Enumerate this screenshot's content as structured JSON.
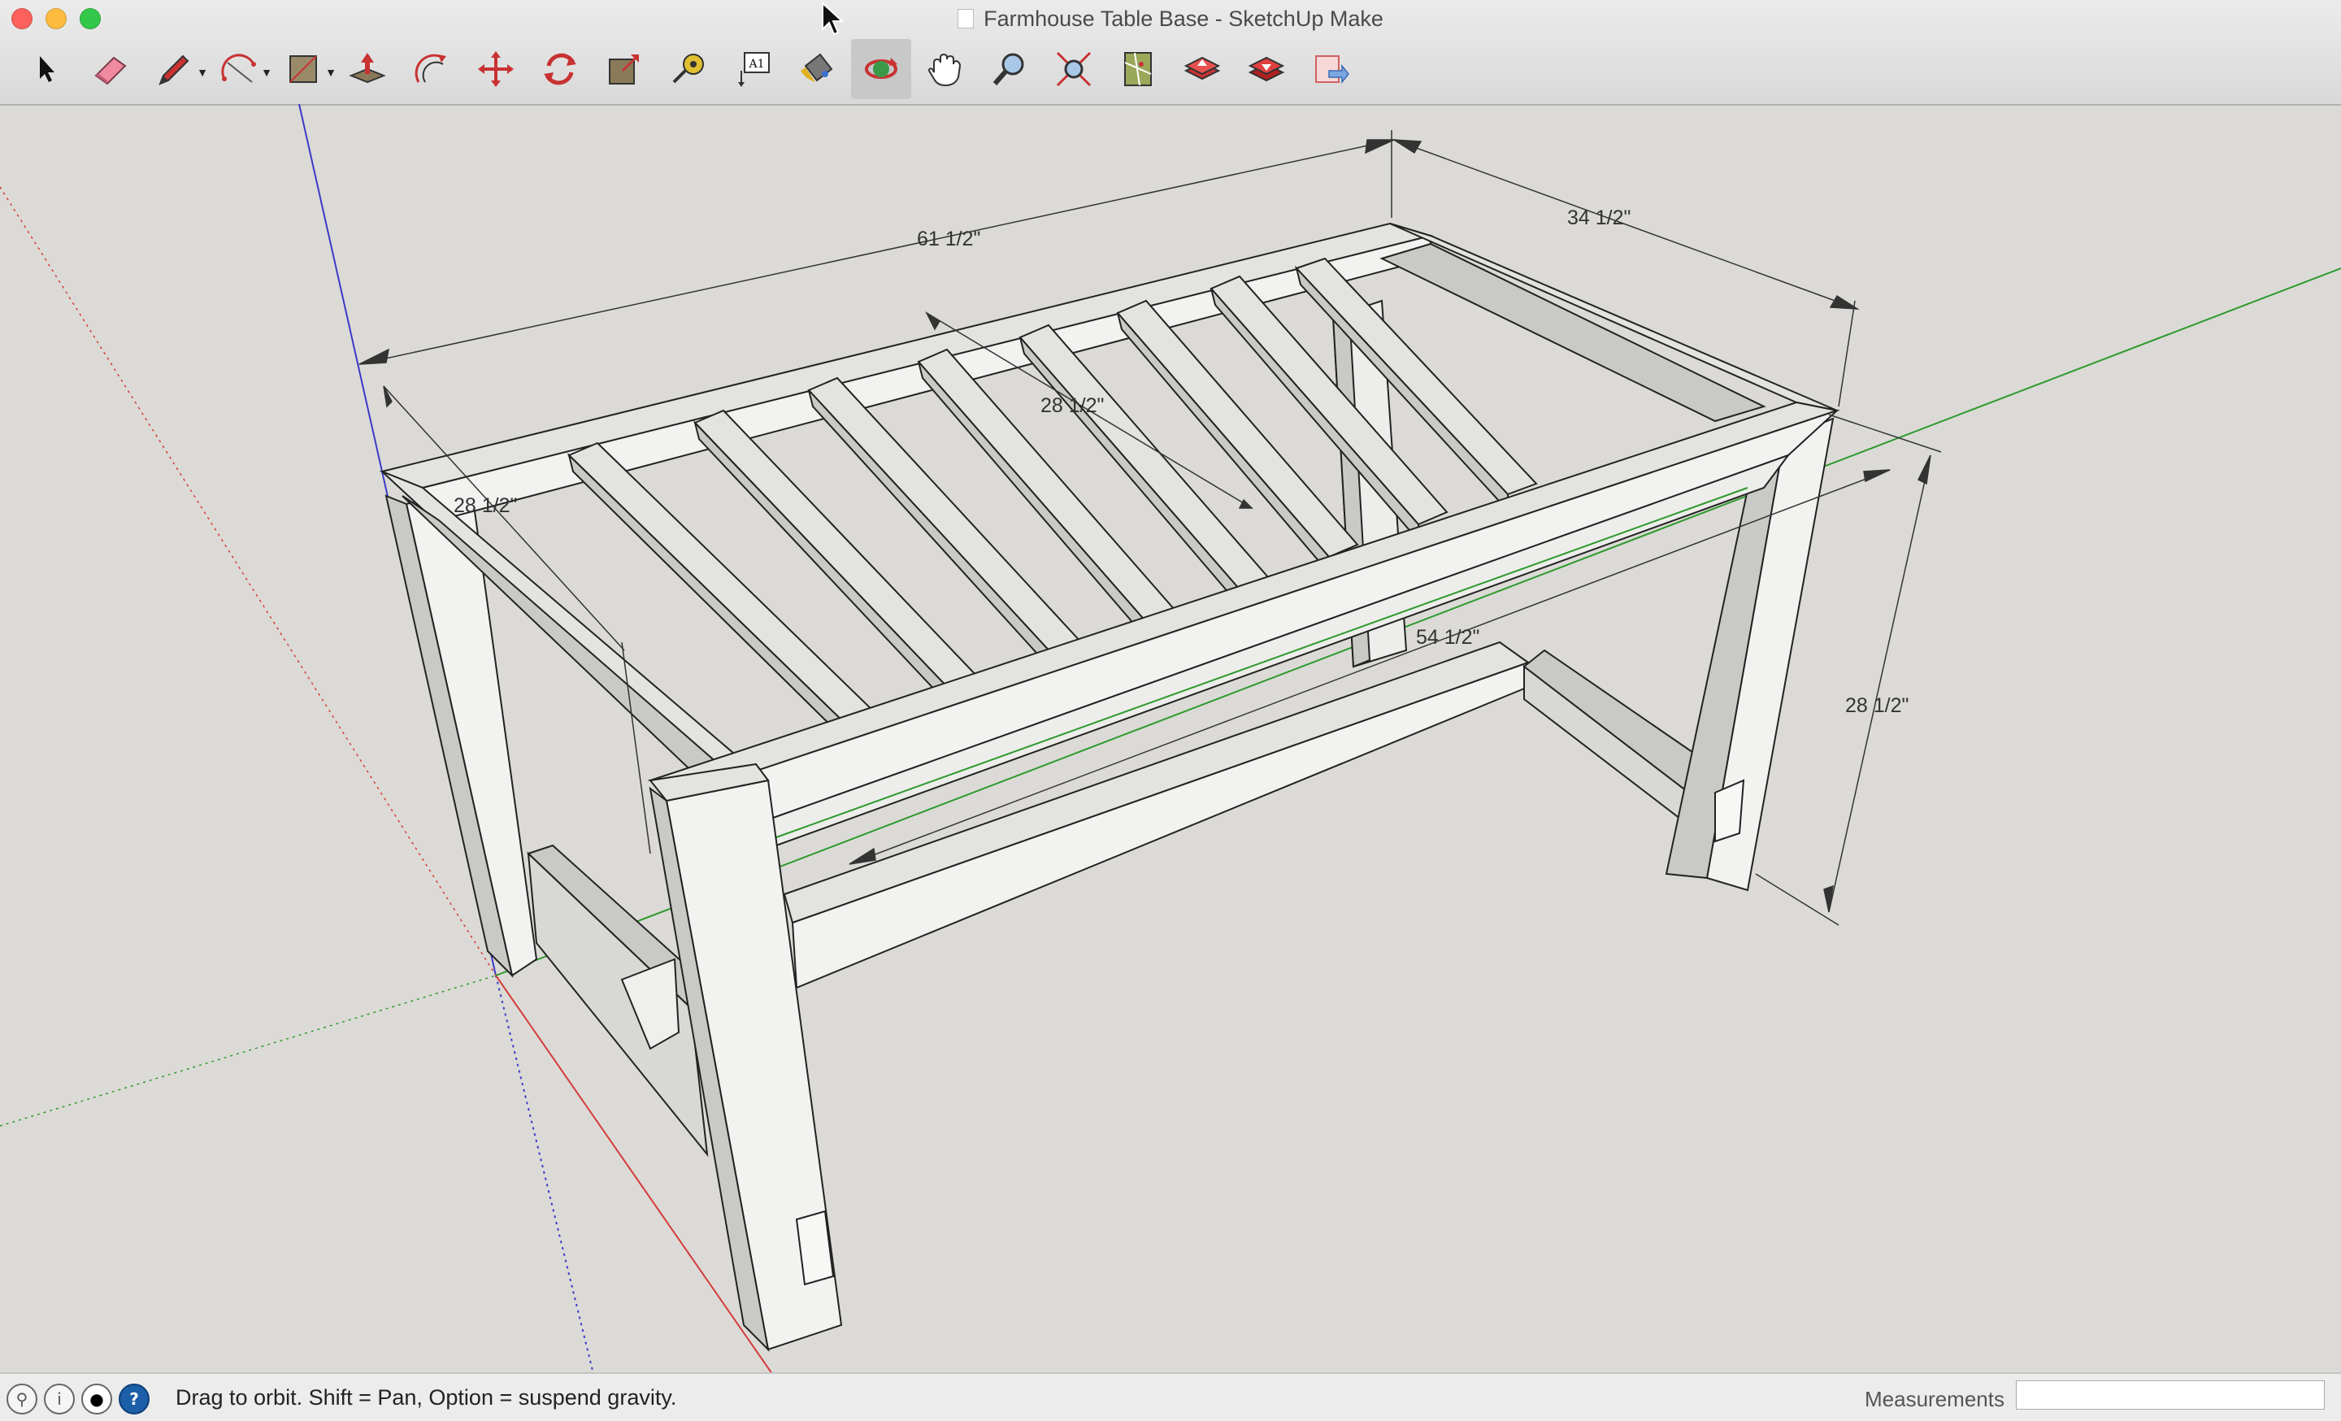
{
  "window": {
    "title": "Farmhouse Table Base - SketchUp Make"
  },
  "toolbar": {
    "tools": [
      {
        "name": "select-tool",
        "icon": "arrow-icon"
      },
      {
        "name": "eraser-tool",
        "icon": "eraser-icon"
      },
      {
        "name": "line-tool",
        "icon": "pencil-icon"
      },
      {
        "name": "arc-tool",
        "icon": "arc-icon"
      },
      {
        "name": "rectangle-tool",
        "icon": "rectangle-icon"
      },
      {
        "name": "push-pull-tool",
        "icon": "push-pull-icon"
      },
      {
        "name": "offset-tool",
        "icon": "offset-icon"
      },
      {
        "name": "move-tool",
        "icon": "move-icon"
      },
      {
        "name": "rotate-tool",
        "icon": "rotate-icon"
      },
      {
        "name": "scale-tool",
        "icon": "scale-icon"
      },
      {
        "name": "tape-measure-tool",
        "icon": "tape-measure-icon"
      },
      {
        "name": "text-tool",
        "icon": "text-icon"
      },
      {
        "name": "paint-bucket-tool",
        "icon": "paint-bucket-icon"
      },
      {
        "name": "orbit-tool",
        "icon": "orbit-icon"
      },
      {
        "name": "pan-tool",
        "icon": "hand-icon"
      },
      {
        "name": "zoom-tool",
        "icon": "magnifier-icon"
      },
      {
        "name": "zoom-extents-tool",
        "icon": "zoom-extents-icon"
      },
      {
        "name": "warehouse-tool",
        "icon": "map-icon"
      },
      {
        "name": "share-model-tool",
        "icon": "share-icon"
      },
      {
        "name": "components-tool",
        "icon": "components-icon"
      },
      {
        "name": "send-to-layout-tool",
        "icon": "layout-icon"
      }
    ],
    "text_tool_glyph": "A1",
    "active_tool": "orbit-tool"
  },
  "dimensions": {
    "overall_length": "61 1/2\"",
    "overall_width": "34 1/2\"",
    "inner_top": "28 1/2\"",
    "inner_left": "28 1/2\"",
    "stretcher_length": "54 1/2\"",
    "height": "28 1/2\""
  },
  "status": {
    "hint": "Drag to orbit. Shift = Pan, Option = suspend gravity.",
    "measurements_label": "Measurements",
    "measurements_value": ""
  },
  "colors": {
    "background": "#dcdad6",
    "axis_red": "#d43c3c",
    "axis_green": "#2e9a2e",
    "axis_blue": "#3a3ac8",
    "wood_front": "#f2f2f0",
    "wood_side": "#c9c9c6",
    "wood_top": "#e3e3e0"
  }
}
